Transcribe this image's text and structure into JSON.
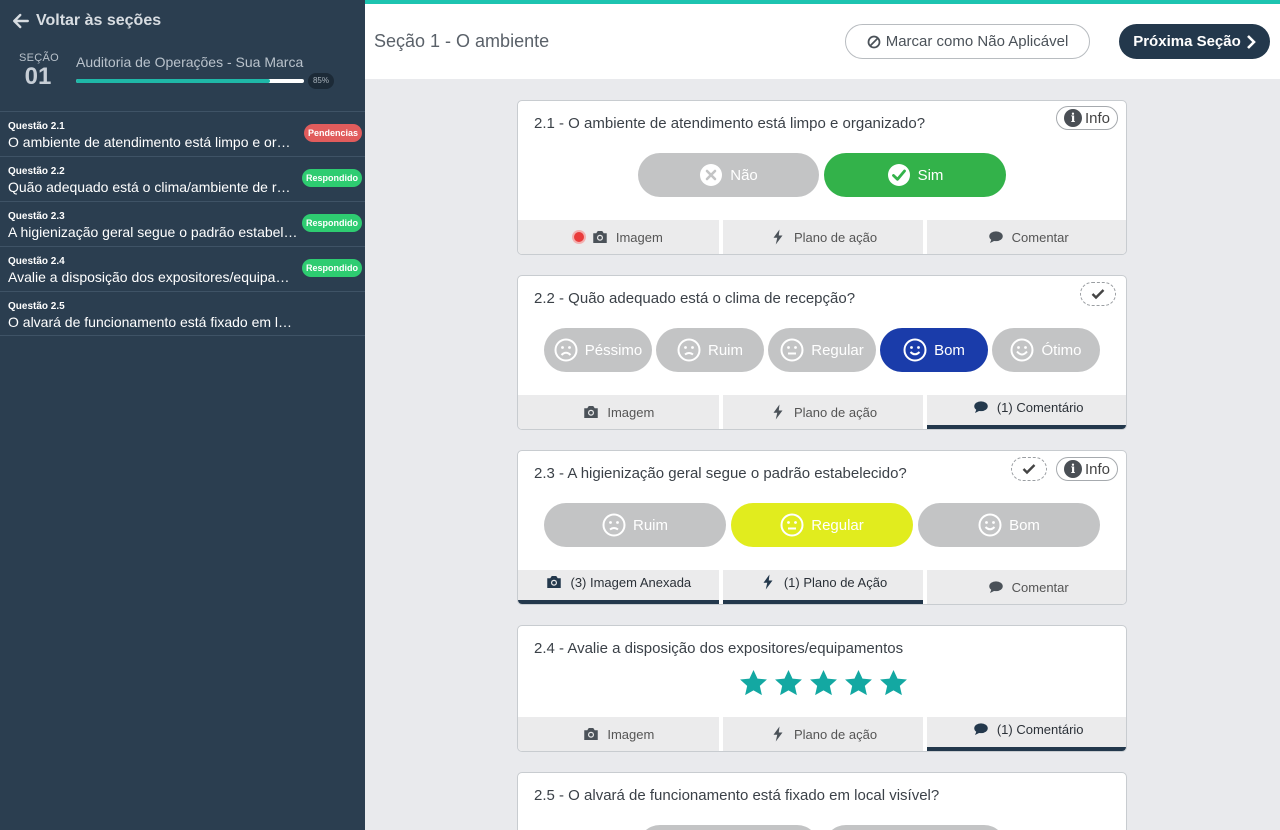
{
  "sidebar": {
    "back_label": "Voltar às seções",
    "section_label": "SEÇÃO",
    "section_number": "01",
    "audit_title": "Auditoria de Operações - Sua Marca",
    "progress_percent": 85,
    "progress_label": "85%",
    "questions": [
      {
        "num": "Questão 2.1",
        "text": "O ambiente de atendimento está limpo e organizado?",
        "badge": "Pendencias",
        "badge_color": "#e15c5c"
      },
      {
        "num": "Questão 2.2",
        "text": "Quão adequado está o clima/ambiente de recepção?",
        "badge": "Respondido",
        "badge_color": "#2ecc71"
      },
      {
        "num": "Questão 2.3",
        "text": "A higienização geral segue o padrão estabelecido?",
        "badge": "Respondido",
        "badge_color": "#2ecc71"
      },
      {
        "num": "Questão 2.4",
        "text": "Avalie a disposição dos expositores/equipamentos",
        "badge": "Respondido",
        "badge_color": "#2ecc71"
      },
      {
        "num": "Questão 2.5",
        "text": "O alvará de funcionamento está fixado em local visível?",
        "badge": "",
        "badge_color": ""
      }
    ]
  },
  "header": {
    "title": "Seção 1 - O ambiente",
    "na_label": "Marcar como Não Aplicável",
    "next_label": "Próxima Seção"
  },
  "colors": {
    "accent": "#1dc4b0",
    "navy": "#23384c",
    "green": "#33b24a",
    "blue_selected": "#1a3caa",
    "yellow_selected": "#e1ec1e",
    "star": "#13a8a2"
  },
  "cards": [
    {
      "title": "2.1 - O ambiente de atendimento está limpo e organizado?",
      "info_label": "Info",
      "options": [
        "Não",
        "Sim"
      ],
      "selected": "Sim",
      "footer": [
        "Imagem",
        "Plano de ação",
        "Comentar"
      ]
    },
    {
      "title": "2.2 - Quão adequado está o clima de recepção?",
      "options": [
        "Péssimo",
        "Ruim",
        "Regular",
        "Bom",
        "Ótimo"
      ],
      "selected": "Bom",
      "footer": [
        "Imagem",
        "Plano de ação",
        "(1) Comentário"
      ]
    },
    {
      "title": "2.3 - A higienização geral segue o padrão estabelecido?",
      "info_label": "Info",
      "options": [
        "Ruim",
        "Regular",
        "Bom"
      ],
      "selected": "Regular",
      "footer": [
        "(3) Imagem Anexada",
        "(1) Plano de Ação",
        "Comentar"
      ]
    },
    {
      "title": "2.4 - Avalie a disposição dos expositores/equipamentos",
      "rating": 5,
      "rating_max": 5,
      "footer": [
        "Imagem",
        "Plano de ação",
        "(1) Comentário"
      ]
    },
    {
      "title": "2.5 - O alvará de funcionamento está fixado em local visível?"
    }
  ]
}
